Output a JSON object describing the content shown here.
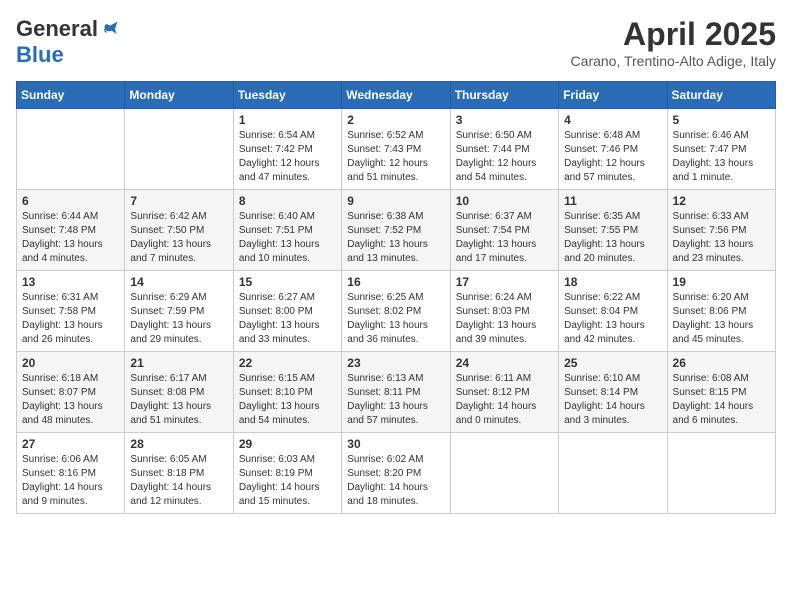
{
  "header": {
    "logo_general": "General",
    "logo_blue": "Blue",
    "month": "April 2025",
    "location": "Carano, Trentino-Alto Adige, Italy"
  },
  "days_of_week": [
    "Sunday",
    "Monday",
    "Tuesday",
    "Wednesday",
    "Thursday",
    "Friday",
    "Saturday"
  ],
  "weeks": [
    [
      {
        "day": "",
        "info": ""
      },
      {
        "day": "",
        "info": ""
      },
      {
        "day": "1",
        "info": "Sunrise: 6:54 AM\nSunset: 7:42 PM\nDaylight: 12 hours and 47 minutes."
      },
      {
        "day": "2",
        "info": "Sunrise: 6:52 AM\nSunset: 7:43 PM\nDaylight: 12 hours and 51 minutes."
      },
      {
        "day": "3",
        "info": "Sunrise: 6:50 AM\nSunset: 7:44 PM\nDaylight: 12 hours and 54 minutes."
      },
      {
        "day": "4",
        "info": "Sunrise: 6:48 AM\nSunset: 7:46 PM\nDaylight: 12 hours and 57 minutes."
      },
      {
        "day": "5",
        "info": "Sunrise: 6:46 AM\nSunset: 7:47 PM\nDaylight: 13 hours and 1 minute."
      }
    ],
    [
      {
        "day": "6",
        "info": "Sunrise: 6:44 AM\nSunset: 7:48 PM\nDaylight: 13 hours and 4 minutes."
      },
      {
        "day": "7",
        "info": "Sunrise: 6:42 AM\nSunset: 7:50 PM\nDaylight: 13 hours and 7 minutes."
      },
      {
        "day": "8",
        "info": "Sunrise: 6:40 AM\nSunset: 7:51 PM\nDaylight: 13 hours and 10 minutes."
      },
      {
        "day": "9",
        "info": "Sunrise: 6:38 AM\nSunset: 7:52 PM\nDaylight: 13 hours and 13 minutes."
      },
      {
        "day": "10",
        "info": "Sunrise: 6:37 AM\nSunset: 7:54 PM\nDaylight: 13 hours and 17 minutes."
      },
      {
        "day": "11",
        "info": "Sunrise: 6:35 AM\nSunset: 7:55 PM\nDaylight: 13 hours and 20 minutes."
      },
      {
        "day": "12",
        "info": "Sunrise: 6:33 AM\nSunset: 7:56 PM\nDaylight: 13 hours and 23 minutes."
      }
    ],
    [
      {
        "day": "13",
        "info": "Sunrise: 6:31 AM\nSunset: 7:58 PM\nDaylight: 13 hours and 26 minutes."
      },
      {
        "day": "14",
        "info": "Sunrise: 6:29 AM\nSunset: 7:59 PM\nDaylight: 13 hours and 29 minutes."
      },
      {
        "day": "15",
        "info": "Sunrise: 6:27 AM\nSunset: 8:00 PM\nDaylight: 13 hours and 33 minutes."
      },
      {
        "day": "16",
        "info": "Sunrise: 6:25 AM\nSunset: 8:02 PM\nDaylight: 13 hours and 36 minutes."
      },
      {
        "day": "17",
        "info": "Sunrise: 6:24 AM\nSunset: 8:03 PM\nDaylight: 13 hours and 39 minutes."
      },
      {
        "day": "18",
        "info": "Sunrise: 6:22 AM\nSunset: 8:04 PM\nDaylight: 13 hours and 42 minutes."
      },
      {
        "day": "19",
        "info": "Sunrise: 6:20 AM\nSunset: 8:06 PM\nDaylight: 13 hours and 45 minutes."
      }
    ],
    [
      {
        "day": "20",
        "info": "Sunrise: 6:18 AM\nSunset: 8:07 PM\nDaylight: 13 hours and 48 minutes."
      },
      {
        "day": "21",
        "info": "Sunrise: 6:17 AM\nSunset: 8:08 PM\nDaylight: 13 hours and 51 minutes."
      },
      {
        "day": "22",
        "info": "Sunrise: 6:15 AM\nSunset: 8:10 PM\nDaylight: 13 hours and 54 minutes."
      },
      {
        "day": "23",
        "info": "Sunrise: 6:13 AM\nSunset: 8:11 PM\nDaylight: 13 hours and 57 minutes."
      },
      {
        "day": "24",
        "info": "Sunrise: 6:11 AM\nSunset: 8:12 PM\nDaylight: 14 hours and 0 minutes."
      },
      {
        "day": "25",
        "info": "Sunrise: 6:10 AM\nSunset: 8:14 PM\nDaylight: 14 hours and 3 minutes."
      },
      {
        "day": "26",
        "info": "Sunrise: 6:08 AM\nSunset: 8:15 PM\nDaylight: 14 hours and 6 minutes."
      }
    ],
    [
      {
        "day": "27",
        "info": "Sunrise: 6:06 AM\nSunset: 8:16 PM\nDaylight: 14 hours and 9 minutes."
      },
      {
        "day": "28",
        "info": "Sunrise: 6:05 AM\nSunset: 8:18 PM\nDaylight: 14 hours and 12 minutes."
      },
      {
        "day": "29",
        "info": "Sunrise: 6:03 AM\nSunset: 8:19 PM\nDaylight: 14 hours and 15 minutes."
      },
      {
        "day": "30",
        "info": "Sunrise: 6:02 AM\nSunset: 8:20 PM\nDaylight: 14 hours and 18 minutes."
      },
      {
        "day": "",
        "info": ""
      },
      {
        "day": "",
        "info": ""
      },
      {
        "day": "",
        "info": ""
      }
    ]
  ]
}
